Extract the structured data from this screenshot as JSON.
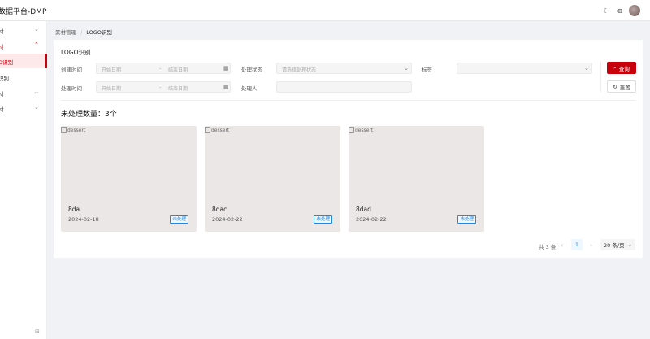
{
  "app": {
    "title": "数据平台-DMP"
  },
  "topbar": {
    "theme_icon": "☾",
    "settings_icon": "⊛"
  },
  "sidebar": {
    "items": [
      {
        "label": "材",
        "chevron": "⌄"
      },
      {
        "label": "材",
        "chevron": "⌃"
      },
      {
        "label": "O识别"
      },
      {
        "label": "识别"
      },
      {
        "label": "材",
        "chevron": "⌄"
      },
      {
        "label": "材",
        "chevron": "⌄"
      }
    ],
    "collapse_icon": "⊞"
  },
  "breadcrumb": {
    "parent": "素材管理",
    "separator": "/",
    "current": "LOGO识别"
  },
  "filter": {
    "title": "LOGO识别",
    "created_label": "创建时间",
    "created_start": "开始日期",
    "created_dash": "-",
    "created_end": "结束日期",
    "status_label": "处理状态",
    "status_placeholder": "请选择处理状态",
    "tag_label": "标签",
    "processed_label": "处理时间",
    "processed_start": "开始日期",
    "processed_dash": "-",
    "processed_end": "结束日期",
    "handler_label": "处理人",
    "query_label": "查询",
    "reset_label": "重置"
  },
  "summary": {
    "label": "未处理数量：3个"
  },
  "cards": [
    {
      "alt": "dessert",
      "name": "8da",
      "date": "2024-02-18",
      "status": "未处理"
    },
    {
      "alt": "dessert",
      "name": "8dac",
      "date": "2024-02-22",
      "status": "未处理"
    },
    {
      "alt": "dessert",
      "name": "8dad",
      "date": "2024-02-22",
      "status": "未处理"
    }
  ],
  "pagination": {
    "total": "共 3 条",
    "prev": "‹",
    "page": "1",
    "next": "›",
    "page_size": "20 条/页"
  },
  "colors": {
    "brand": "#c7000b",
    "tag_blue": "#1e88e5",
    "card_bg": "#ebe7e6"
  }
}
